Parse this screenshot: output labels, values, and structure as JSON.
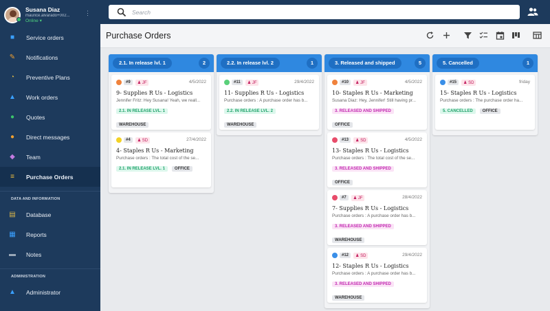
{
  "user": {
    "name": "Susana Diaz",
    "email": "maurice.alvarado+002...",
    "status": "Online ▾"
  },
  "sidebar": {
    "items": [
      {
        "label": "Service orders",
        "icon": "briefcase-icon",
        "color": "#3aa0ff"
      },
      {
        "label": "Notifications",
        "icon": "wrench-icon",
        "color": "#f0a030"
      },
      {
        "label": "Preventive Plans",
        "icon": "pie-chart-icon",
        "color": "#d9b64a"
      },
      {
        "label": "Work orders",
        "icon": "helmet-icon",
        "color": "#3aa0ff"
      },
      {
        "label": "Quotes",
        "icon": "money-bag-icon",
        "color": "#3cc46b"
      },
      {
        "label": "Direct messages",
        "icon": "chat-icon",
        "color": "#f0a030"
      },
      {
        "label": "Team",
        "icon": "team-icon",
        "color": "#c27ae0"
      },
      {
        "label": "Purchase Orders",
        "icon": "sliders-icon",
        "color": "#f0c040",
        "active": true
      }
    ],
    "section_data": "DATA AND INFORMATION",
    "data_items": [
      {
        "label": "Database",
        "icon": "database-icon",
        "color": "#d9b64a"
      },
      {
        "label": "Reports",
        "icon": "report-icon",
        "color": "#3aa0ff"
      },
      {
        "label": "Notes",
        "icon": "folder-icon",
        "color": "#9aa8b8"
      }
    ],
    "section_admin": "ADMINISTRATION",
    "admin_items": [
      {
        "label": "Administrator",
        "icon": "admin-icon",
        "color": "#3aa0ff"
      }
    ]
  },
  "search": {
    "placeholder": "Search"
  },
  "page": {
    "title": "Purchase Orders"
  },
  "columns": [
    {
      "name": "2.1. In release lvl. 1",
      "count": "2",
      "cards": [
        {
          "dot": "#f0823c",
          "id": "#9",
          "user": "JF",
          "date": "4/5/2022",
          "title": "9- Supplies R Us - Logistics",
          "desc": "Jennifer Fritz: Hey Susana! Yeah, we reall...",
          "status": "2.1. IN RELEASE LVL. 1",
          "statusType": "release",
          "tag": "WAREHOUSE",
          "tagInline": false
        },
        {
          "dot": "#f3d226",
          "id": "#4",
          "user": "SD",
          "date": "27/4/2022",
          "title": "4- Staples R Us - Marketing",
          "desc": "Purchase orders : The total cost of the se...",
          "status": "2.1. IN RELEASE LVL. 1",
          "statusType": "release",
          "tag": "OFFICE",
          "tagInline": true
        }
      ]
    },
    {
      "name": "2.2. In release lvl. 2",
      "count": "1",
      "cards": [
        {
          "dot": "#5ad07a",
          "id": "#11",
          "user": "JF",
          "date": "29/4/2022",
          "title": "11- Supplies R Us - Logistics",
          "desc": "Purchase orders : A purchase order has b...",
          "status": "2.2. IN RELEASE LVL. 2",
          "statusType": "release",
          "tag": "WAREHOUSE",
          "tagInline": false
        }
      ]
    },
    {
      "name": "3. Released and shipped",
      "count": "5",
      "cards": [
        {
          "dot": "#f0823c",
          "id": "#10",
          "user": "JF",
          "date": "4/5/2022",
          "title": "10- Staples R Us - Marketing",
          "desc": "Susana Diaz: Hey, Jennifer! Still having pr...",
          "status": "3. RELEASED AND SHIPPED",
          "statusType": "shipped",
          "tag": "OFFICE",
          "tagInline": false
        },
        {
          "dot": "#e84c6a",
          "id": "#13",
          "user": "SD",
          "date": "4/5/2022",
          "title": "13- Staples R Us - Logistics",
          "desc": "Purchase orders : The total cost of the se...",
          "status": "3. RELEASED AND SHIPPED",
          "statusType": "shipped",
          "tag": "OFFICE",
          "tagInline": false
        },
        {
          "dot": "#e84c6a",
          "id": "#7",
          "user": "JF",
          "date": "28/4/2022",
          "title": "7- Supplies R Us - Logistics",
          "desc": "Purchase orders : A purchase order has b...",
          "status": "3. RELEASED AND SHIPPED",
          "statusType": "shipped",
          "tag": "WAREHOUSE",
          "tagInline": false
        },
        {
          "dot": "#3a8fe8",
          "id": "#12",
          "user": "SD",
          "date": "29/4/2022",
          "title": "12- Staples R Us - Logistics",
          "desc": "Purchase orders : A purchase order has b...",
          "status": "3. RELEASED AND SHIPPED",
          "statusType": "shipped",
          "tag": "WAREHOUSE",
          "tagInline": false
        }
      ]
    },
    {
      "name": "5. Cancelled",
      "count": "1",
      "cards": [
        {
          "dot": "#3a8fe8",
          "id": "#15",
          "user": "SD",
          "date": "friday",
          "title": "15- Staples R Us - Logistics",
          "desc": "Purchase orders : The purchase order ha...",
          "status": "5. CANCELLED",
          "statusType": "cancel",
          "tag": "OFFICE",
          "tagInline": true
        }
      ]
    }
  ]
}
